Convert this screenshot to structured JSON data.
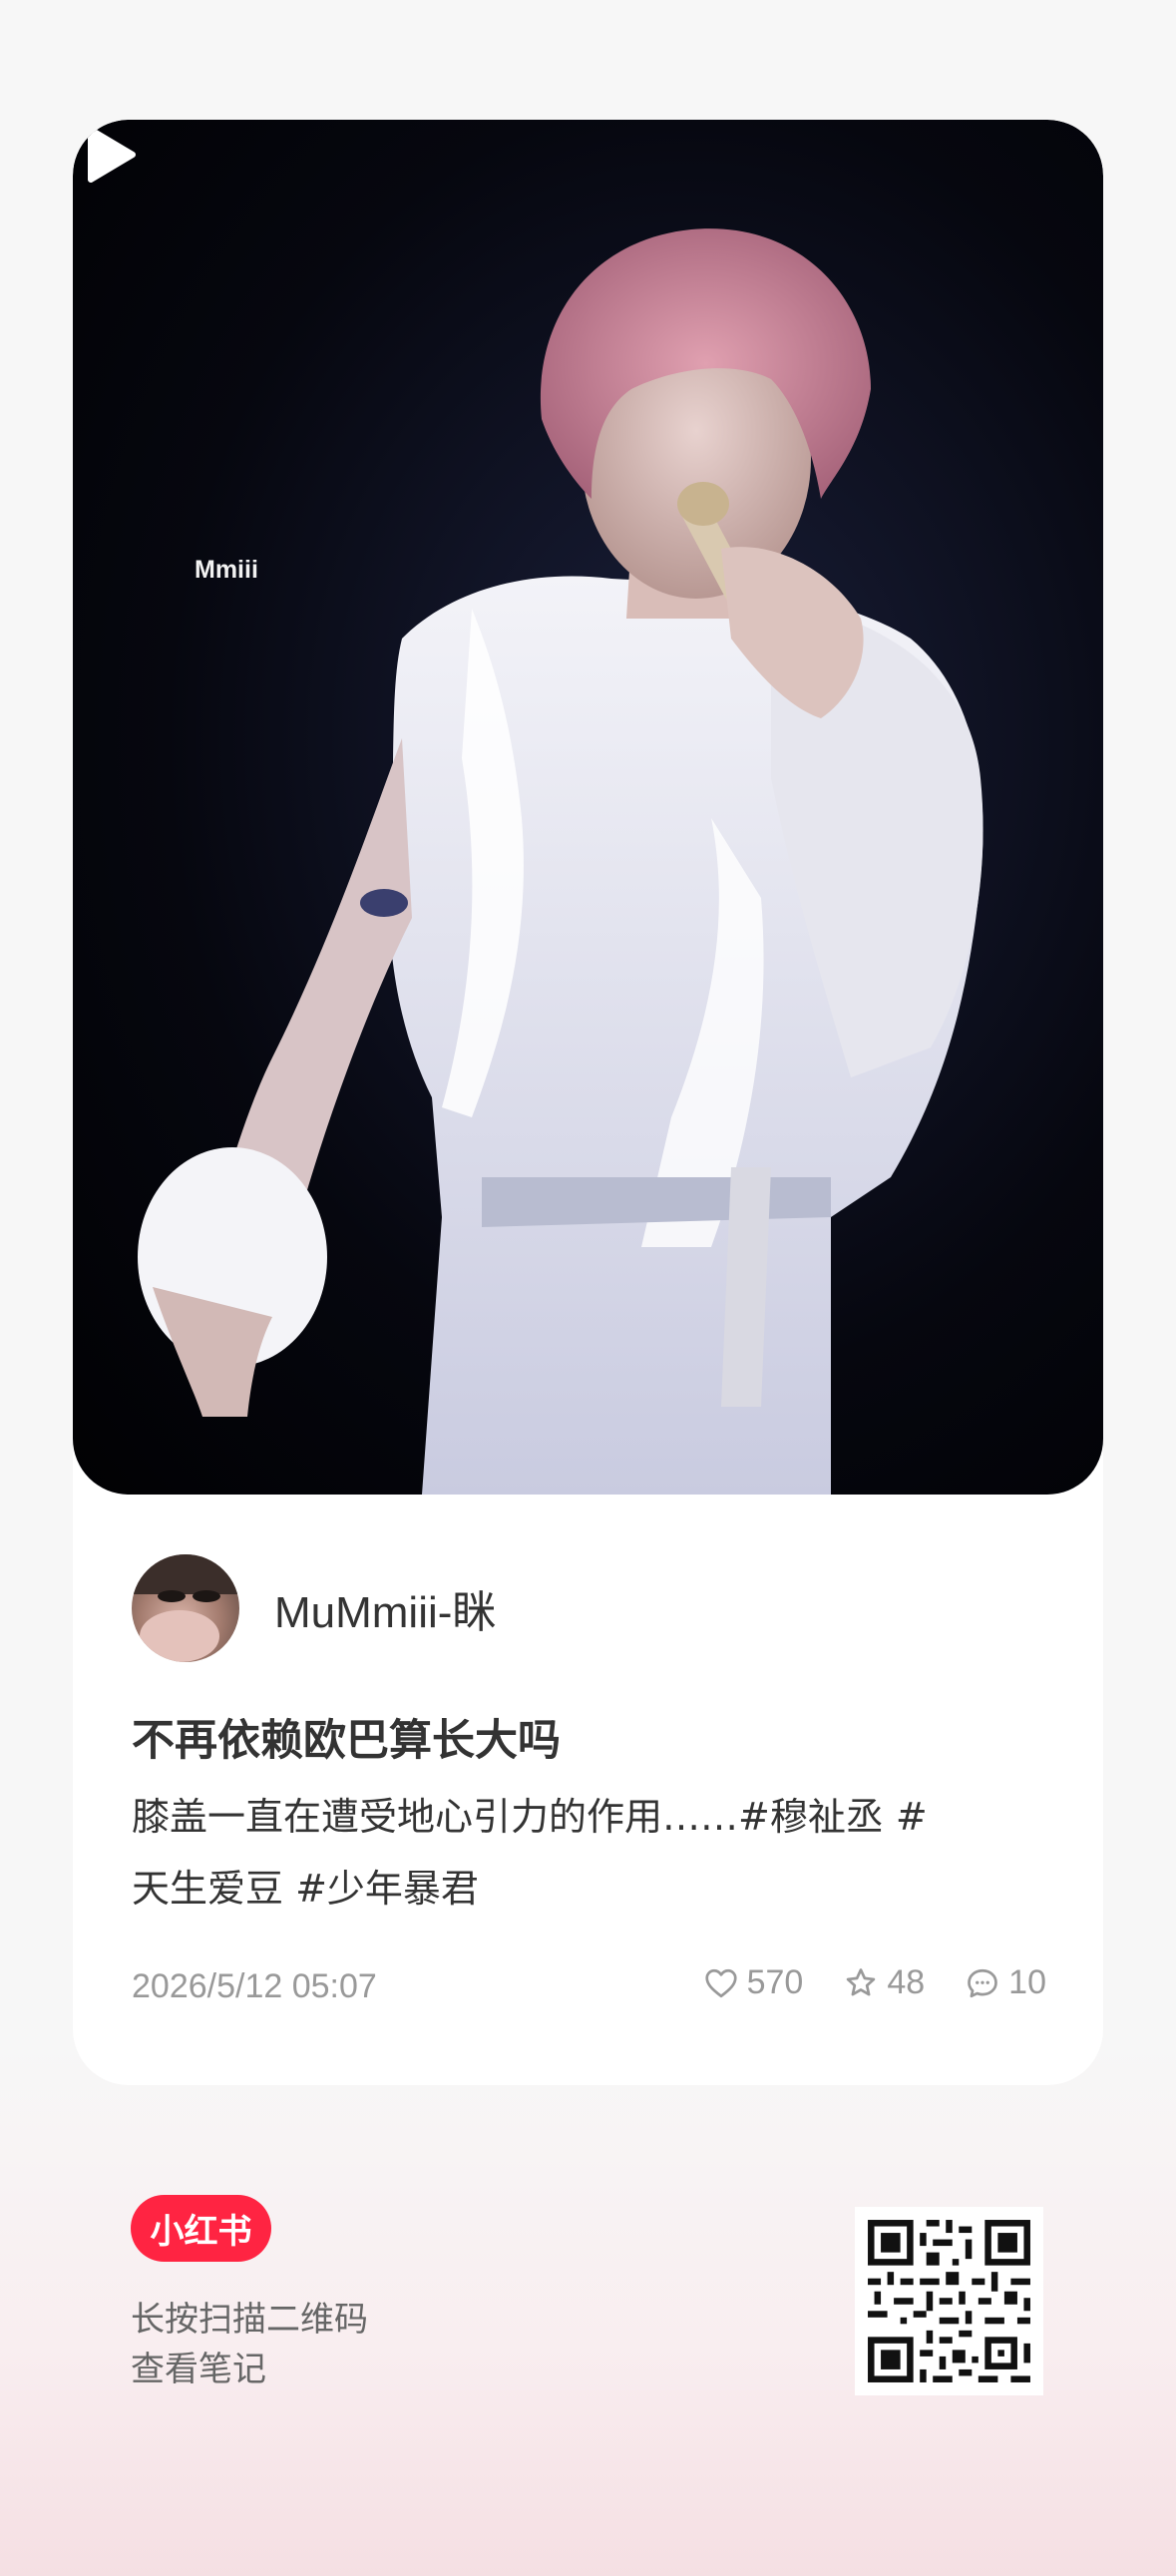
{
  "post": {
    "watermark": "Mmiii",
    "author_name": "MuMmiii-眯",
    "title": "不再依赖欧巴算长大吗",
    "description_line1": "膝盖一直在遭受地心引力的作用……#穆祉丞  #",
    "description_line2": "天生爱豆  #少年暴君",
    "date": "2026/5/12 05:07",
    "likes": "570",
    "collects": "48",
    "comments": "10"
  },
  "footer": {
    "brand": "小红书",
    "scan_line1": "长按扫描二维码",
    "scan_line2": "查看笔记"
  },
  "colors": {
    "brand_red": "#ff2442",
    "text_primary": "#333333",
    "text_secondary": "#999999"
  },
  "icons": {
    "play": "play-icon",
    "like": "heart-icon",
    "collect": "star-icon",
    "comment": "comment-icon",
    "qr": "qr-code-icon"
  }
}
